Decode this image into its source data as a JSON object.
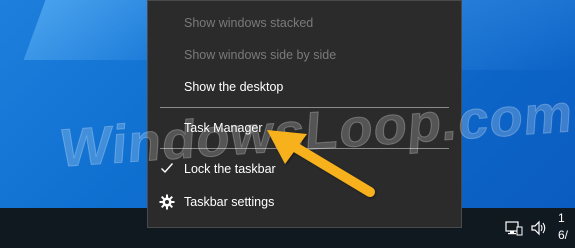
{
  "context_menu": {
    "items": [
      {
        "label": "Show windows stacked",
        "enabled": false
      },
      {
        "label": "Show windows side by side",
        "enabled": false
      },
      {
        "label": "Show the desktop",
        "enabled": true
      },
      {
        "label": "Task Manager",
        "enabled": true
      },
      {
        "label": "Lock the taskbar",
        "enabled": true,
        "checked": true
      },
      {
        "label": "Taskbar settings",
        "enabled": true,
        "icon": "gear-icon"
      }
    ]
  },
  "tray": {
    "icons": [
      "network-icon",
      "volume-icon"
    ],
    "time_line1": "1",
    "time_line2": "6/"
  },
  "watermark": "WindowsLoop.com",
  "annotation": {
    "arrow_color": "#f6b11c",
    "arrow_icon": "arrow-icon"
  },
  "colors": {
    "menu_bg": "#2b2b2b",
    "desktop": "#0f6fd0",
    "taskbar": "#101820"
  }
}
